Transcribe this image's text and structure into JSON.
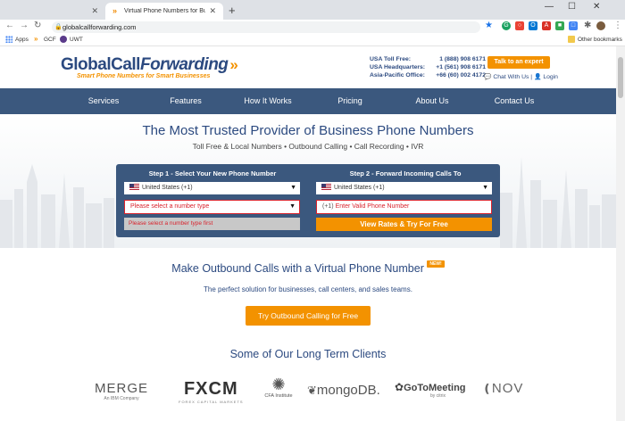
{
  "browser": {
    "tabs": [
      {
        "title": ""
      },
      {
        "title": "Virtual Phone Numbers for Busin"
      }
    ],
    "url": "globalcallforwarding.com",
    "bookmarks": [
      "Apps",
      "GCF",
      "UWT"
    ],
    "other_bookmarks": "Other bookmarks"
  },
  "header": {
    "logo_main_1": "GlobalCall",
    "logo_main_2": "Forwarding",
    "logo_tagline": "Smart Phone Numbers for Smart Businesses",
    "contacts": [
      {
        "label": "USA Toll Free:",
        "value": "1 (888) 908 6171"
      },
      {
        "label": "USA Headquarters:",
        "value": "+1 (561) 908 6171"
      },
      {
        "label": "Asia-Pacific Office:",
        "value": "+66 (60) 002 4172"
      }
    ],
    "talk_button": "Talk to an expert",
    "chat": "Chat With Us",
    "login": "Login"
  },
  "nav": [
    "Services",
    "Features",
    "How It Works",
    "Pricing",
    "About Us",
    "Contact Us"
  ],
  "hero": {
    "title": "The Most Trusted Provider of Business Phone Numbers",
    "subtitle": "Toll Free & Local Numbers • Outbound Calling • Call Recording • IVR"
  },
  "form": {
    "step1": "Step 1 - Select Your New Phone Number",
    "step2": "Step 2 - Forward Incoming Calls To",
    "country1": "United States (+1)",
    "country2": "United States (+1)",
    "number_type_placeholder": "Please select a number type",
    "phone_prefix": "(+1)",
    "phone_placeholder": "Enter Valid Phone Number",
    "error_msg": "Please select a number type first",
    "view_button": "View Rates & Try For Free"
  },
  "outbound": {
    "title": "Make Outbound Calls with a Virtual Phone Number",
    "badge": "NEW!",
    "subtitle": "The perfect solution for businesses, call centers, and sales teams.",
    "button": "Try Outbound Calling for Free"
  },
  "clients": {
    "title": "Some of Our Long Term Clients",
    "logos": {
      "merge": "MERGE",
      "merge_sub": "An IBM Company",
      "fxcm": "FXCM",
      "fxcm_sub": "FOREX CAPITAL MARKETS",
      "cfa": "CFA Institute",
      "mongodb": "mongoDB.",
      "goto": "GoToMeeting",
      "goto_sub": "by citrix",
      "nov": "NOV"
    }
  },
  "colors": {
    "navy": "#3b587e",
    "orange": "#f39200",
    "title_blue": "#2c4a80",
    "error_red": "#d9232d"
  }
}
